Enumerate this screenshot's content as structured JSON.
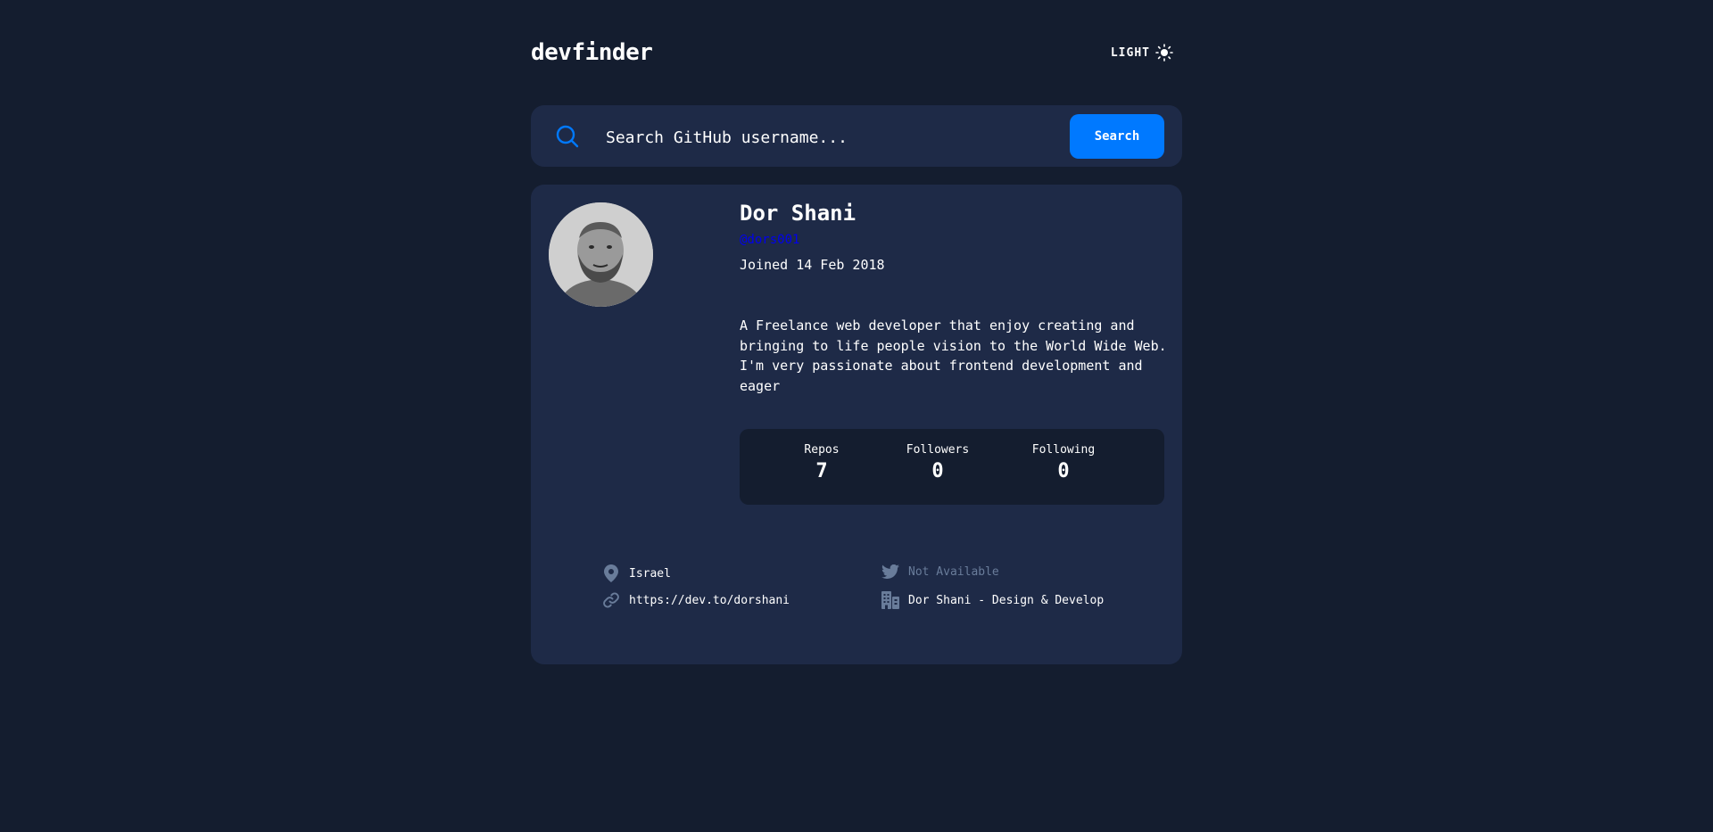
{
  "header": {
    "logo": "devfinder",
    "theme_label": "LIGHT",
    "theme_icon": "sun-icon"
  },
  "search": {
    "placeholder": "Search GitHub username...",
    "value": "",
    "button_label": "Search",
    "icon": "search-icon"
  },
  "profile": {
    "name": "Dor Shani",
    "login": "@dors001",
    "joined": "Joined 14 Feb 2018",
    "bio": "A Freelance web developer that enjoy creating and bringing to life people vision to the World Wide Web. I'm very passionate about frontend development and eager",
    "stats": [
      {
        "label": "Repos",
        "value": "7"
      },
      {
        "label": "Followers",
        "value": "0"
      },
      {
        "label": "Following",
        "value": "0"
      }
    ],
    "links": {
      "location": "Israel",
      "blog": "https://dev.to/dorshani",
      "twitter": "Not Available",
      "company": "Dor Shani - Design & Develop"
    }
  },
  "colors": {
    "background": "#141d2f",
    "card": "#1e2a47",
    "accent": "#0079ff",
    "muted": "#697c9a"
  }
}
